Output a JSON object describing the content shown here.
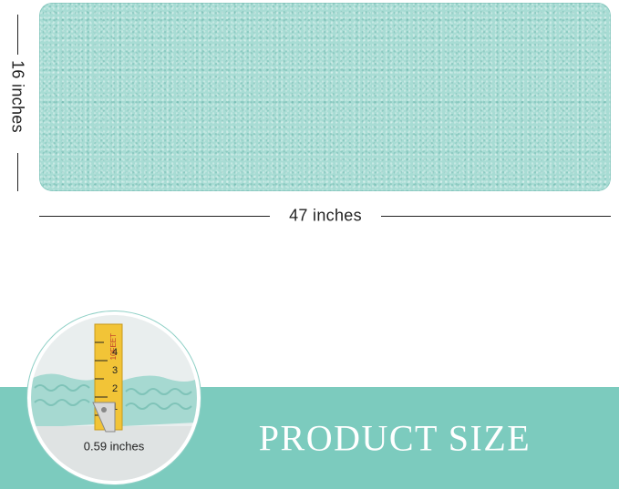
{
  "dimensions": {
    "height_label": "16 inches",
    "width_label": "47 inches"
  },
  "detail": {
    "thickness_label": "0.59 inches",
    "tape_marks": [
      "1",
      "2",
      "3",
      "4"
    ],
    "tape_text": "10FEET"
  },
  "banner": {
    "title": "PRODUCT SIZE"
  },
  "colors": {
    "mat": "#a8dcd4",
    "band": "#7ccbbe",
    "text": "#222222"
  }
}
